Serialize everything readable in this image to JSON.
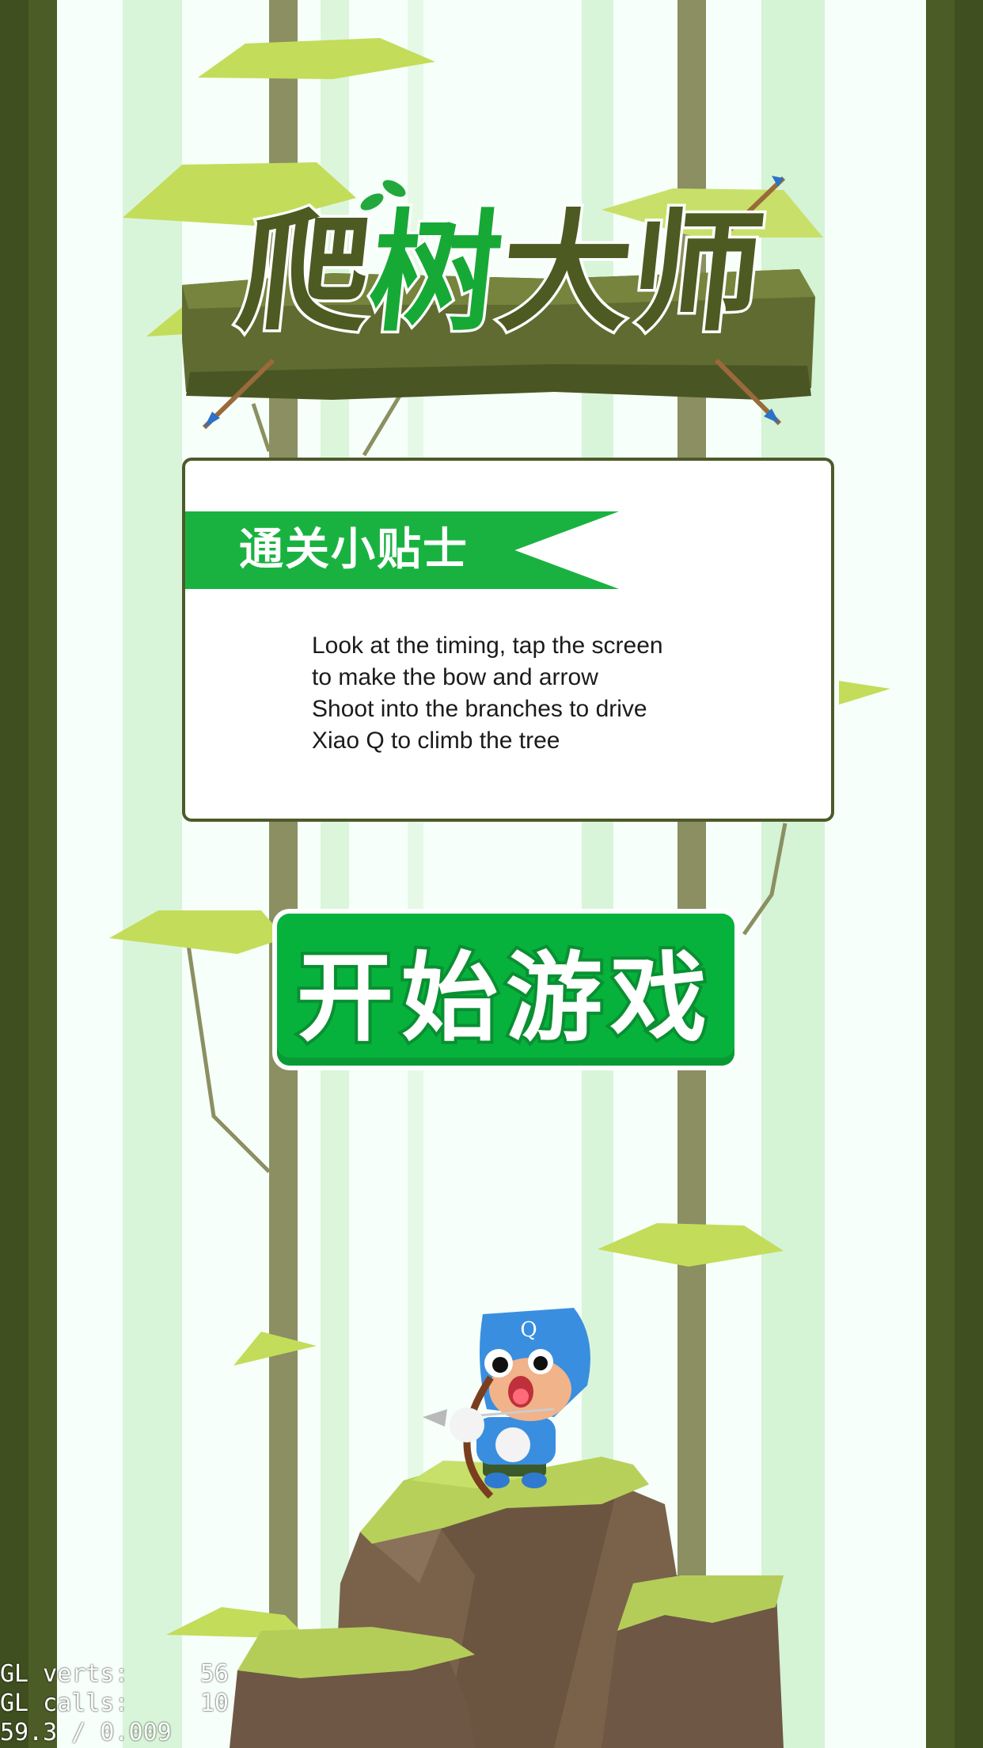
{
  "game": {
    "title_chars": [
      "爬",
      "树",
      "大",
      "师"
    ],
    "tips_header": "通关小贴士",
    "tip_lines": [
      "Look at the timing, tap the screen",
      "to make the bow and arrow",
      "Shoot into the branches to drive",
      "Xiao Q to climb the tree"
    ],
    "start_button_label": "开始游戏",
    "character_letter": "Q"
  },
  "debug": {
    "line1": "GL verts:     56",
    "line2": "GL calls:     10",
    "line3": "59.3 / 0.009"
  },
  "colors": {
    "forest_dark": "#4a5a25",
    "pale_stripe": "#d9f5d9",
    "trunk": "#8c8f62",
    "leaf": "#c3dc5a",
    "brand_green": "#09b23c",
    "character_blue": "#3a8ee0"
  }
}
